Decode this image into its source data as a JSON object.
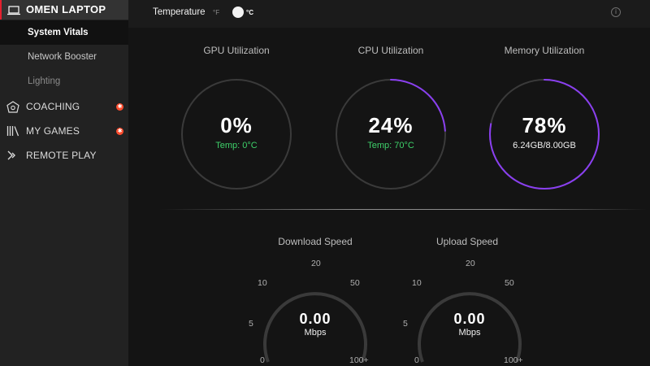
{
  "sidebar": {
    "device": {
      "label": "OMEN LAPTOP",
      "icon": "laptop-icon"
    },
    "subitems": [
      {
        "label": "System Vitals",
        "active": true
      },
      {
        "label": "Network Booster",
        "active": false
      },
      {
        "label": "Lighting",
        "active": false
      }
    ],
    "items": [
      {
        "label": "COACHING",
        "icon": "coaching-icon",
        "badge": "new-badge"
      },
      {
        "label": "MY GAMES",
        "icon": "games-library-icon",
        "badge": "new-badge"
      },
      {
        "label": "REMOTE PLAY",
        "icon": "remote-play-icon"
      }
    ]
  },
  "header": {
    "temperature_label": "Temperature",
    "unit_f": "°F",
    "unit_c": "°C",
    "selected_unit": "°C",
    "info_icon": "info-icon"
  },
  "vitals": [
    {
      "title": "GPU Utilization",
      "value": "0%",
      "detail": "Temp: 0°C",
      "progress": 0.0
    },
    {
      "title": "CPU Utilization",
      "value": "24%",
      "detail": "Temp: 70°C",
      "progress": 0.24
    },
    {
      "title": "Memory Utilization",
      "value": "78%",
      "detail": "6.24GB/8.00GB",
      "progress": 0.78
    }
  ],
  "network": {
    "ticks": [
      "0",
      "5",
      "10",
      "20",
      "50",
      "100+"
    ],
    "download": {
      "title": "Download Speed",
      "value": "0.00",
      "unit": "Mbps"
    },
    "upload": {
      "title": "Upload Speed",
      "value": "0.00",
      "unit": "Mbps"
    }
  },
  "colors": {
    "accent_red": "#e5202e",
    "ring_purple": "#8a3ff0",
    "temp_green": "#3ed16a",
    "badge_orange": "#ff4d2e"
  }
}
